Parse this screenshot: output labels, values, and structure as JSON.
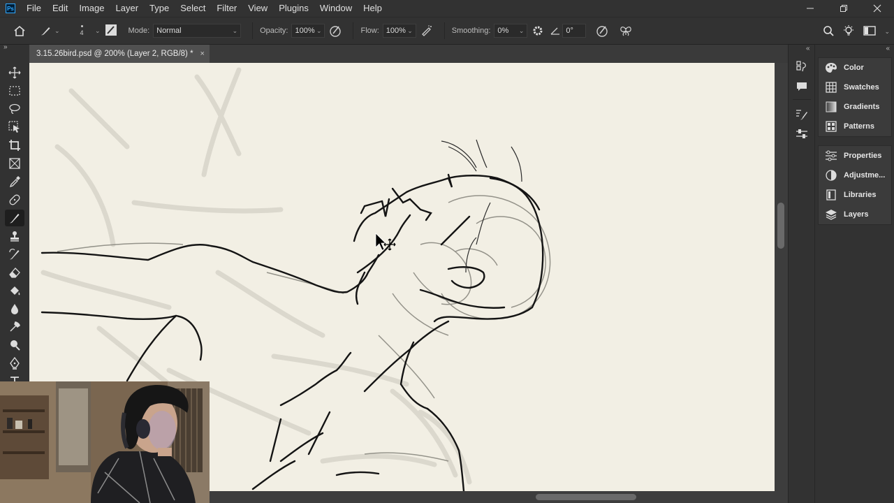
{
  "menubar": {
    "logo": "Ps",
    "items": [
      "File",
      "Edit",
      "Image",
      "Layer",
      "Type",
      "Select",
      "Filter",
      "View",
      "Plugins",
      "Window",
      "Help"
    ],
    "window_controls": [
      "minimize-icon",
      "restore-icon",
      "close-icon"
    ]
  },
  "options": {
    "brush_size": "4",
    "mode_label": "Mode:",
    "mode_value": "Normal",
    "opacity_label": "Opacity:",
    "opacity_value": "100%",
    "flow_label": "Flow:",
    "flow_value": "100%",
    "smoothing_label": "Smoothing:",
    "smoothing_value": "0%",
    "angle_value": "0°"
  },
  "document": {
    "tab_title": "3.15.26bird.psd @ 200% (Layer 2, RGB/8) *",
    "close_glyph": "×",
    "canvas_color": "#f2efe4"
  },
  "toolbar": {
    "collapse_glyph": "»",
    "tools": [
      "move-tool",
      "marquee-tool",
      "lasso-tool",
      "object-select-tool",
      "crop-tool",
      "frame-tool",
      "eyedropper-tool",
      "healing-tool",
      "brush-tool",
      "stamp-tool",
      "history-brush-tool",
      "eraser-tool",
      "paint-bucket-tool",
      "blur-tool",
      "smudge-tool",
      "dodge-tool",
      "pen-tool",
      "type-tool"
    ],
    "active_tool": "brush-tool"
  },
  "panels": {
    "collapse_glyph": "«",
    "group1": [
      "Color",
      "Swatches",
      "Gradients",
      "Patterns"
    ],
    "group2": [
      "Properties",
      "Adjustme...",
      "Libraries",
      "Layers"
    ]
  },
  "colors": {
    "accent": "#31a8ff",
    "chrome": "#323232",
    "workspace": "#535353"
  }
}
